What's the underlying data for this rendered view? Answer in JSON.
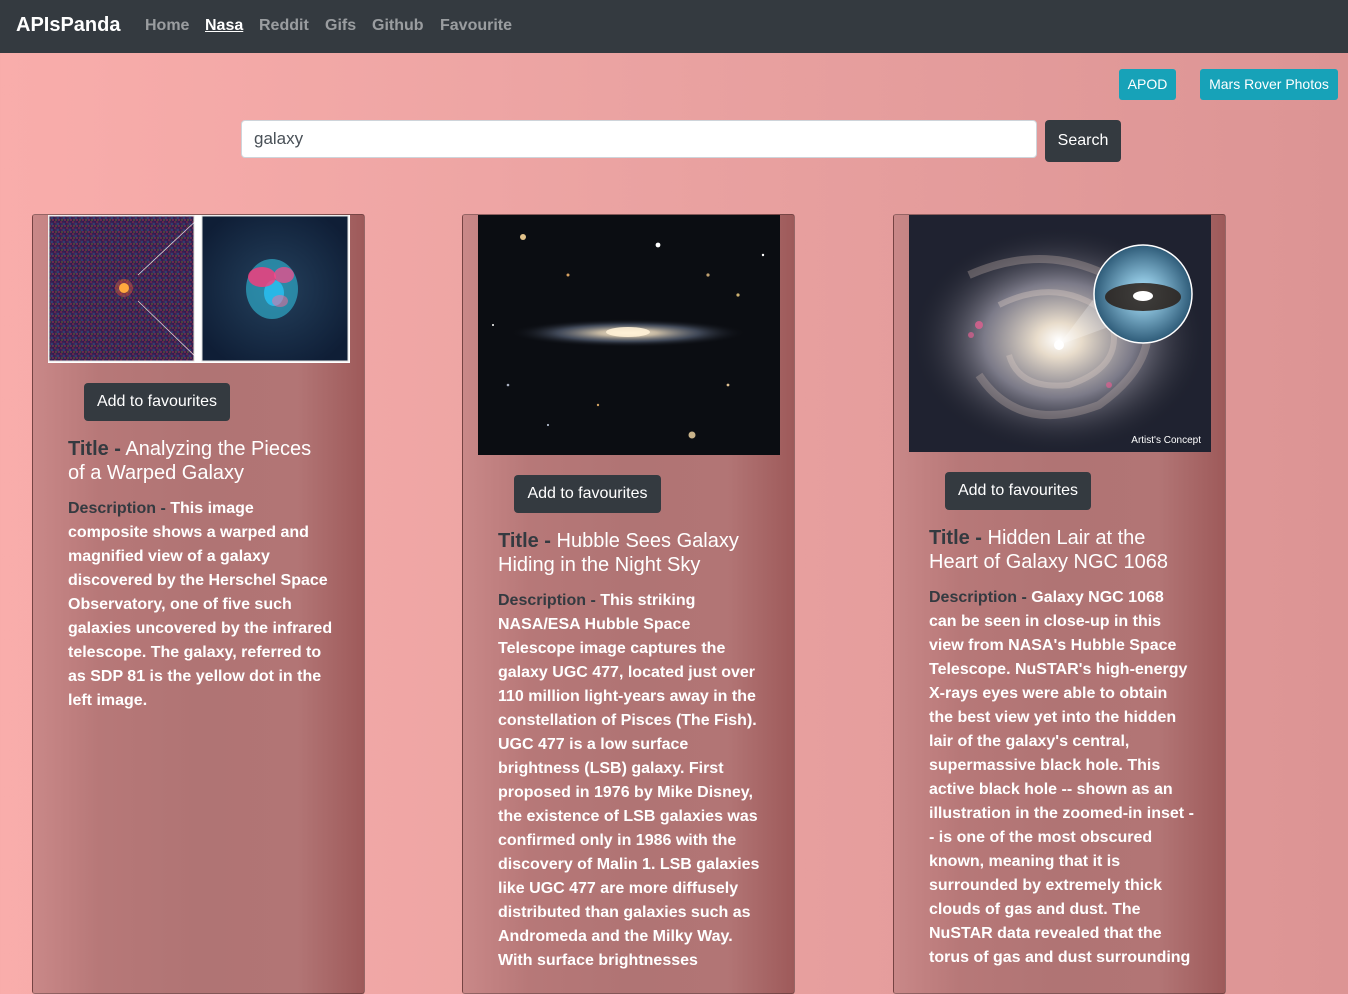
{
  "navbar": {
    "brand": "APIsPanda",
    "links": [
      {
        "label": "Home",
        "active": false
      },
      {
        "label": "Nasa",
        "active": true
      },
      {
        "label": "Reddit",
        "active": false
      },
      {
        "label": "Gifs",
        "active": false
      },
      {
        "label": "Github",
        "active": false
      },
      {
        "label": "Favourite",
        "active": false
      }
    ]
  },
  "nasa_tabs": {
    "apod": "APOD",
    "mars": "Mars Rover Photos"
  },
  "search": {
    "value": "galaxy",
    "button": "Search"
  },
  "cards": [
    {
      "fav_label": "Add to favourites",
      "title_label": "Title -",
      "title": "Analyzing the Pieces of a Warped Galaxy",
      "desc_label": "Description -",
      "description": "This image composite shows a warped and magnified view of a galaxy discovered by the Herschel Space Observatory, one of five such galaxies uncovered by the infrared telescope. The galaxy, referred to as SDP 81 is the yellow dot in the left image."
    },
    {
      "fav_label": "Add to favourites",
      "title_label": "Title -",
      "title": "Hubble Sees Galaxy Hiding in the Night Sky",
      "desc_label": "Description -",
      "description": "This striking NASA/ESA Hubble Space Telescope image captures the galaxy UGC 477, located just over 110 million light-years away in the constellation of Pisces (The Fish). UGC 477 is a low surface brightness (LSB) galaxy. First proposed in 1976 by Mike Disney, the existence of LSB galaxies was confirmed only in 1986 with the discovery of Malin 1. LSB galaxies like UGC 477 are more diffusely distributed than galaxies such as Andromeda and the Milky Way. With surface brightnesses"
    },
    {
      "fav_label": "Add to favourites",
      "title_label": "Title -",
      "title": "Hidden Lair at the Heart of Galaxy NGC 1068",
      "desc_label": "Description -",
      "description": "Galaxy NGC 1068 can be seen in close-up in this view from NASA's Hubble Space Telescope. NuSTAR's high-energy X-rays eyes were able to obtain the best view yet into the hidden lair of the galaxy's central, supermassive black hole. This active black hole -- shown as an illustration in the zoomed-in inset -- is one of the most obscured known, meaning that it is surrounded by extremely thick clouds of gas and dust. The NuSTAR data revealed that the torus of gas and dust surrounding",
      "image_caption": "Artist's Concept"
    }
  ]
}
